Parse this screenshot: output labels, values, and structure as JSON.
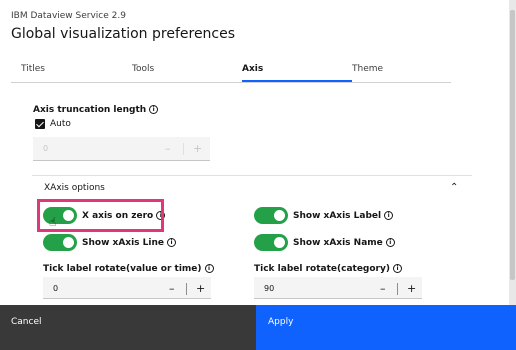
{
  "header": {
    "subtitle": "IBM Dataview Service 2.9",
    "title": "Global visualization preferences"
  },
  "tabs": [
    {
      "label": "Titles",
      "active": false
    },
    {
      "label": "Tools",
      "active": false
    },
    {
      "label": "Axis",
      "active": true
    },
    {
      "label": "Theme",
      "active": false
    }
  ],
  "axis_truncation": {
    "label": "Axis truncation length",
    "auto_label": "Auto",
    "auto_checked": true,
    "value": "0",
    "minus": "–",
    "plus": "+"
  },
  "xaxis": {
    "section_title": "XAxis options",
    "toggles": {
      "axis_on_zero": "X axis on zero",
      "show_label": "Show xAxis Label",
      "show_line": "Show xAxis Line",
      "show_name": "Show xAxis Name"
    },
    "tick_rotate_value": {
      "label": "Tick label rotate(value or time)",
      "value": "0"
    },
    "tick_rotate_category": {
      "label": "Tick label rotate(category)",
      "value": "90"
    }
  },
  "footer": {
    "cancel": "Cancel",
    "apply": "Apply"
  },
  "colors": {
    "accent": "#0f62fe",
    "toggle_on": "#24a148",
    "highlight": "#e0367a",
    "cancel_bg": "#393939"
  },
  "icons": [
    "info-icon",
    "checkmark-icon",
    "chevron-up-icon",
    "hand-cursor-icon"
  ]
}
